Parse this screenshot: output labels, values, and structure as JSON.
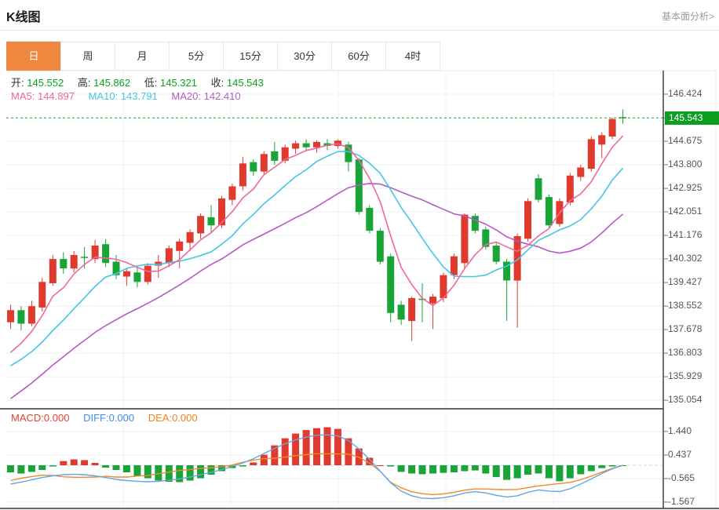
{
  "header": {
    "title": "K线图",
    "link": "基本面分析>"
  },
  "tabs": [
    {
      "key": "day",
      "label": "日",
      "active": true
    },
    {
      "key": "week",
      "label": "周",
      "active": false
    },
    {
      "key": "month",
      "label": "月",
      "active": false
    },
    {
      "key": "5min",
      "label": "5分",
      "active": false
    },
    {
      "key": "15min",
      "label": "15分",
      "active": false
    },
    {
      "key": "30min",
      "label": "30分",
      "active": false
    },
    {
      "key": "60min",
      "label": "60分",
      "active": false
    },
    {
      "key": "4hour",
      "label": "4时",
      "active": false
    }
  ],
  "ohlc": {
    "open_label": "开:",
    "open": "145.552",
    "high_label": "高:",
    "high": "145.862",
    "low_label": "低:",
    "low": "145.321",
    "close_label": "收:",
    "close": "145.543"
  },
  "ma_row": {
    "ma5_label": "MA5:",
    "ma5": "144.897",
    "ma10_label": "MA10:",
    "ma10": "143.791",
    "ma20_label": "MA20:",
    "ma20": "142.410"
  },
  "macd_row": {
    "macd_label": "MACD:",
    "macd": "0.000",
    "diff_label": "DIFF:",
    "diff": "0.000",
    "dea_label": "DEA:",
    "dea": "0.000"
  },
  "price_axis": {
    "current": "145.543"
  },
  "colors": {
    "candle_up": "#e0392d",
    "candle_down": "#18a437",
    "ohlc_value": "#0aa21c",
    "ma5": "#f0679e",
    "ma10": "#45c6e2",
    "ma20": "#b55ac4",
    "macd_label": "#e8402e",
    "diff_label": "#3d8ee8",
    "dea_label": "#f5821f",
    "macd_line_diff": "#64a6e4",
    "macd_line_dea": "#f08a2b",
    "current_price_bg": "#0b9e20",
    "current_price_line": "#12a327",
    "tab_active_bg": "#f0873f",
    "grid": "#edf1f6",
    "axis_text": "#555555",
    "border_dark": "#333333",
    "border_light": "#e8e8e8",
    "macd_zero_line": "#c3d9ee"
  },
  "chart_data": [
    {
      "type": "candlestick",
      "title": "K线图 (日)",
      "legend": [
        "MA5",
        "MA10",
        "MA20"
      ],
      "y_ticks": [
        "146.424",
        "145.543",
        "144.675",
        "143.800",
        "142.925",
        "142.051",
        "141.176",
        "140.302",
        "139.427",
        "138.552",
        "137.678",
        "136.803",
        "135.929",
        "135.054"
      ],
      "grid_ticks": [
        146.424,
        144.675,
        143.8,
        142.925,
        142.051,
        141.176,
        140.302,
        139.427,
        138.552,
        137.678,
        136.803,
        135.929,
        135.054
      ],
      "current_price": 145.543,
      "ylim": [
        134.8,
        147.3
      ],
      "ma_periods": [
        5,
        10,
        20
      ],
      "pre_closes": [
        131.8,
        132.2,
        132.6,
        133.0,
        133.4,
        133.8,
        134.2,
        134.5,
        134.8,
        135.1,
        135.3,
        135.5,
        135.7,
        135.9,
        136.0,
        136.1,
        136.2,
        136.35,
        136.5,
        136.7
      ],
      "candles": [
        [
          137.95,
          138.6,
          137.7,
          138.4
        ],
        [
          138.4,
          138.55,
          137.65,
          137.9
        ],
        [
          137.9,
          138.75,
          137.8,
          138.55
        ],
        [
          138.5,
          139.6,
          138.35,
          139.45
        ],
        [
          139.4,
          140.45,
          139.3,
          140.3
        ],
        [
          140.3,
          140.55,
          139.75,
          139.95
        ],
        [
          139.95,
          140.6,
          139.8,
          140.45
        ],
        [
          140.38,
          140.75,
          139.95,
          140.34
        ],
        [
          140.3,
          141.0,
          140.15,
          140.8
        ],
        [
          140.85,
          141.05,
          140.0,
          140.15
        ],
        [
          140.2,
          140.45,
          139.55,
          139.7
        ],
        [
          139.65,
          139.95,
          139.3,
          139.85
        ],
        [
          139.8,
          140.0,
          139.25,
          139.45
        ],
        [
          139.45,
          140.15,
          139.35,
          140.05
        ],
        [
          140.05,
          140.45,
          139.6,
          140.2
        ],
        [
          140.15,
          140.8,
          140.0,
          140.7
        ],
        [
          140.6,
          141.05,
          139.95,
          140.95
        ],
        [
          140.9,
          141.4,
          140.6,
          141.3
        ],
        [
          141.25,
          142.0,
          141.05,
          141.9
        ],
        [
          141.85,
          142.3,
          141.3,
          141.55
        ],
        [
          141.55,
          142.65,
          141.45,
          142.55
        ],
        [
          142.5,
          143.1,
          142.3,
          143.0
        ],
        [
          143.0,
          144.1,
          142.85,
          143.85
        ],
        [
          143.9,
          144.0,
          143.4,
          143.55
        ],
        [
          143.55,
          144.3,
          143.45,
          144.2
        ],
        [
          144.3,
          144.65,
          143.8,
          143.95
        ],
        [
          143.95,
          144.55,
          143.85,
          144.45
        ],
        [
          144.4,
          144.7,
          144.2,
          144.6
        ],
        [
          144.6,
          144.75,
          144.3,
          144.45
        ],
        [
          144.45,
          144.7,
          144.25,
          144.65
        ],
        [
          144.6,
          144.75,
          144.35,
          144.5
        ],
        [
          144.5,
          144.75,
          144.4,
          144.7
        ],
        [
          144.55,
          144.65,
          143.55,
          143.9
        ],
        [
          144.0,
          144.05,
          141.95,
          142.05
        ],
        [
          142.2,
          142.3,
          141.25,
          141.35
        ],
        [
          141.35,
          141.45,
          140.1,
          140.2
        ],
        [
          140.4,
          140.5,
          137.95,
          138.3
        ],
        [
          138.6,
          138.75,
          137.85,
          138.05
        ],
        [
          138.0,
          138.9,
          137.25,
          138.85
        ],
        [
          138.82,
          139.4,
          137.95,
          138.78
        ],
        [
          138.65,
          139.0,
          137.7,
          138.9
        ],
        [
          138.85,
          139.8,
          138.7,
          139.7
        ],
        [
          139.7,
          140.5,
          139.55,
          140.4
        ],
        [
          140.15,
          142.0,
          139.95,
          141.95
        ],
        [
          141.9,
          142.0,
          141.25,
          141.35
        ],
        [
          141.4,
          141.5,
          140.65,
          140.75
        ],
        [
          140.8,
          140.9,
          140.1,
          140.2
        ],
        [
          140.2,
          140.3,
          138.0,
          139.5
        ],
        [
          139.5,
          141.25,
          137.75,
          141.15
        ],
        [
          141.05,
          142.55,
          140.95,
          142.45
        ],
        [
          143.3,
          143.45,
          142.4,
          142.5
        ],
        [
          142.6,
          142.7,
          141.45,
          141.55
        ],
        [
          141.6,
          142.55,
          141.5,
          142.45
        ],
        [
          142.4,
          143.5,
          142.3,
          143.4
        ],
        [
          143.35,
          143.8,
          143.2,
          143.7
        ],
        [
          143.65,
          144.85,
          143.55,
          144.75
        ],
        [
          144.55,
          145.0,
          144.05,
          144.9
        ],
        [
          144.85,
          145.55,
          144.75,
          145.5
        ],
        [
          145.552,
          145.862,
          145.321,
          145.543
        ]
      ]
    },
    {
      "type": "bar",
      "title": "MACD(12,26,9)",
      "legend": [
        "MACD",
        "DIFF",
        "DEA"
      ],
      "y_ticks": [
        "1.440",
        "0.437",
        "-0.565",
        "-1.567"
      ],
      "ylim": [
        -1.9,
        1.9
      ],
      "histogram": [
        -0.3,
        -0.35,
        -0.28,
        -0.2,
        -0.05,
        0.18,
        0.25,
        0.22,
        0.1,
        -0.1,
        -0.2,
        -0.3,
        -0.45,
        -0.55,
        -0.65,
        -0.7,
        -0.72,
        -0.65,
        -0.55,
        -0.4,
        -0.25,
        -0.12,
        -0.05,
        0.12,
        0.45,
        0.85,
        1.15,
        1.35,
        1.5,
        1.58,
        1.62,
        1.55,
        1.15,
        0.72,
        0.32,
        0.0,
        -0.05,
        -0.28,
        -0.35,
        -0.38,
        -0.35,
        -0.32,
        -0.3,
        -0.25,
        -0.22,
        -0.35,
        -0.5,
        -0.62,
        -0.55,
        -0.4,
        -0.35,
        -0.55,
        -0.68,
        -0.55,
        -0.38,
        -0.25,
        -0.12,
        -0.05,
        -0.01
      ],
      "diff": [
        -0.8,
        -0.72,
        -0.62,
        -0.52,
        -0.45,
        -0.4,
        -0.38,
        -0.4,
        -0.45,
        -0.52,
        -0.6,
        -0.65,
        -0.68,
        -0.7,
        -0.68,
        -0.64,
        -0.58,
        -0.5,
        -0.4,
        -0.3,
        -0.18,
        -0.05,
        0.1,
        0.28,
        0.5,
        0.72,
        0.92,
        1.08,
        1.2,
        1.28,
        1.3,
        1.25,
        1.05,
        0.7,
        0.25,
        -0.25,
        -0.75,
        -1.1,
        -1.3,
        -1.4,
        -1.42,
        -1.38,
        -1.3,
        -1.18,
        -1.12,
        -1.18,
        -1.28,
        -1.35,
        -1.3,
        -1.15,
        -1.05,
        -1.1,
        -1.12,
        -1.0,
        -0.8,
        -0.58,
        -0.35,
        -0.15,
        0.0
      ],
      "dea": [
        -0.65,
        -0.55,
        -0.48,
        -0.42,
        -0.43,
        -0.49,
        -0.51,
        -0.51,
        -0.5,
        -0.47,
        -0.5,
        -0.5,
        -0.46,
        -0.43,
        -0.36,
        -0.29,
        -0.22,
        -0.18,
        -0.13,
        -0.1,
        -0.06,
        0.01,
        0.13,
        0.22,
        0.28,
        0.3,
        0.35,
        0.41,
        0.45,
        0.49,
        0.49,
        0.48,
        0.48,
        0.34,
        0.09,
        -0.25,
        -0.73,
        -0.96,
        -1.13,
        -1.21,
        -1.25,
        -1.22,
        -1.15,
        -1.06,
        -1.01,
        -1.01,
        -1.03,
        -1.04,
        -1.03,
        -0.95,
        -0.88,
        -0.83,
        -0.78,
        -0.73,
        -0.61,
        -0.46,
        -0.29,
        -0.13,
        0.0
      ]
    }
  ]
}
